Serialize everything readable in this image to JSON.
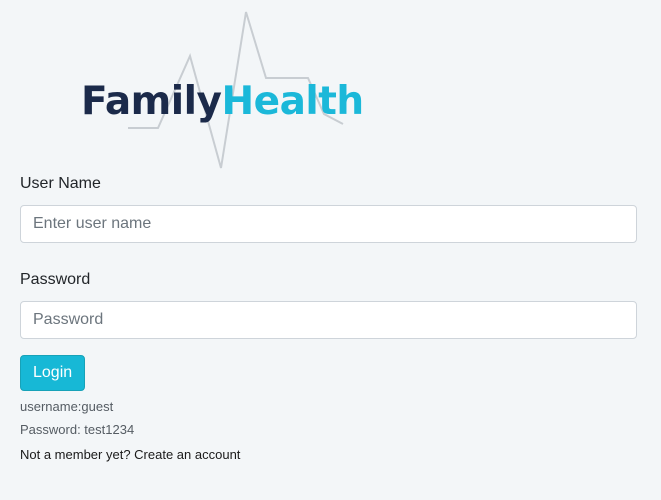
{
  "logo": {
    "family": "Family",
    "health": "Health",
    "colors": {
      "family": "#1b2a4a",
      "health": "#1bb8d9",
      "pulse": "#c8cdd2"
    }
  },
  "form": {
    "username_label": "User Name",
    "username_placeholder": "Enter user name",
    "username_value": "",
    "password_label": "Password",
    "password_placeholder": "Password",
    "password_value": "",
    "login_label": "Login",
    "hint_username": "username:guest",
    "hint_password": "Password: test1234",
    "signup_prefix": "Not a member yet?",
    "signup_link": "Create an account"
  },
  "colors": {
    "background": "#f3f6f8",
    "accent": "#17b8d6"
  }
}
